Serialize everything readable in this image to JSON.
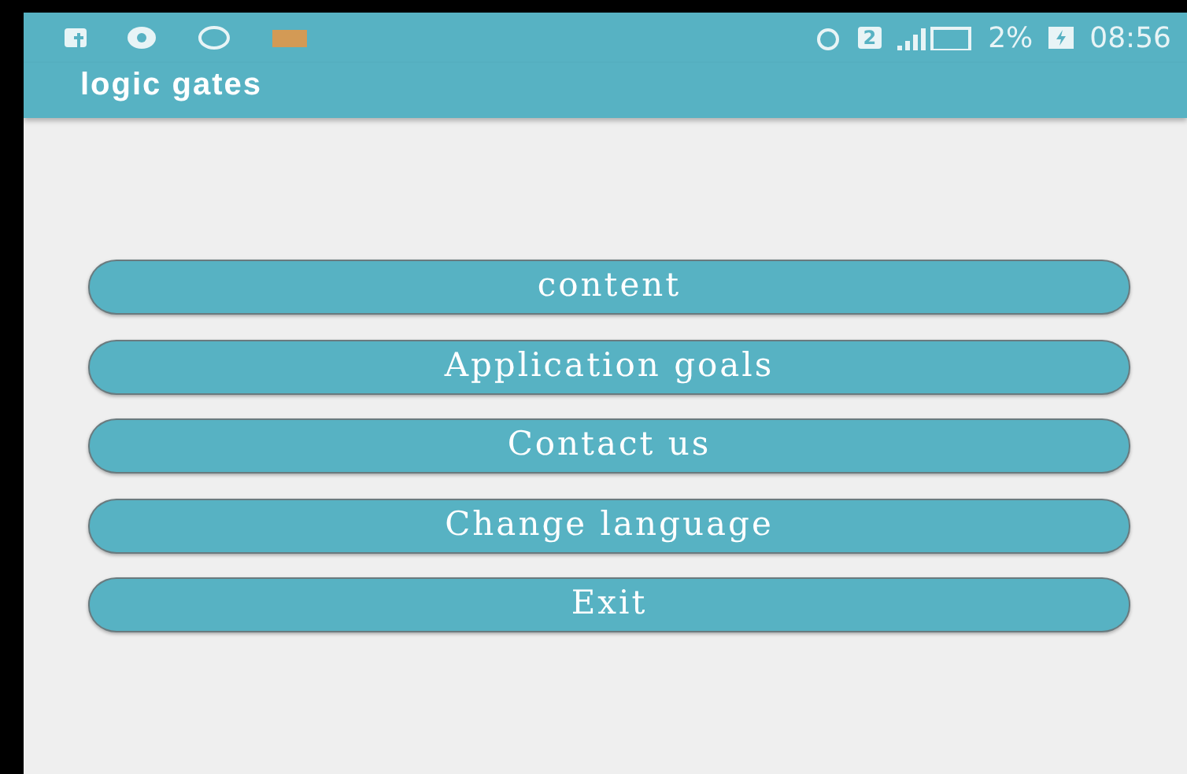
{
  "status_bar": {
    "sim_badge": "2",
    "battery": "2%",
    "time": "08:56"
  },
  "app_bar": {
    "title": "logic gates"
  },
  "menu": [
    {
      "label": "content"
    },
    {
      "label": "Application goals"
    },
    {
      "label": "Contact us"
    },
    {
      "label": "Change language"
    },
    {
      "label": "Exit"
    }
  ]
}
